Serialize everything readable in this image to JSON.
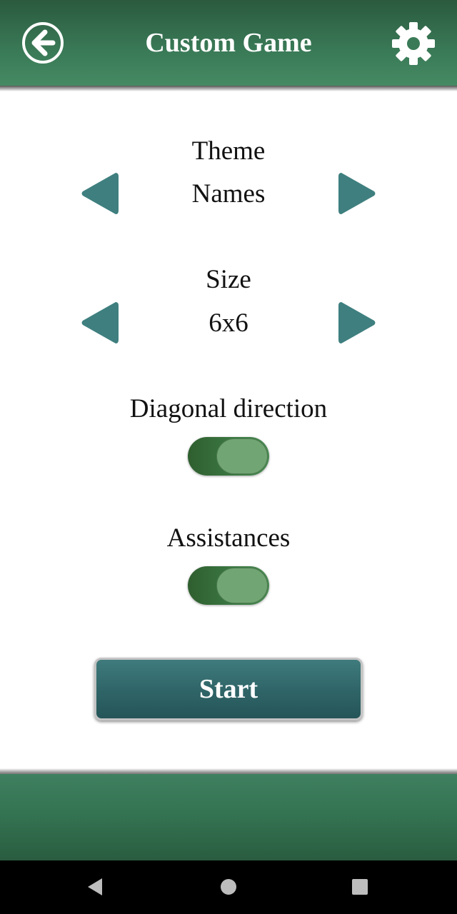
{
  "header": {
    "title": "Custom Game",
    "back_icon": "arrow-left-circle-icon",
    "settings_icon": "gear-icon"
  },
  "settings": {
    "theme": {
      "label": "Theme",
      "value": "Names"
    },
    "size": {
      "label": "Size",
      "value": "6x6"
    },
    "diagonal": {
      "label": "Diagonal direction",
      "enabled": true
    },
    "assistances": {
      "label": "Assistances",
      "enabled": true
    }
  },
  "start_button": {
    "label": "Start"
  },
  "colors": {
    "header_green": "#3a7a57",
    "arrow_teal": "#3f7f7f",
    "toggle_green": "#3c7a44",
    "start_teal": "#2f6467"
  },
  "system_nav": {
    "back_icon": "nav-back-icon",
    "home_icon": "nav-home-icon",
    "recents_icon": "nav-recents-icon"
  }
}
